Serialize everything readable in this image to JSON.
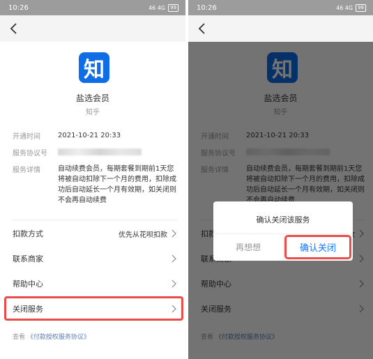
{
  "status_bar": {
    "time": "10:26",
    "signal": "46 4G",
    "battery": "99"
  },
  "service": {
    "logo_char": "知",
    "name": "盐选会员",
    "merchant": "知乎"
  },
  "info": {
    "open_time_label": "开通时间",
    "open_time_value": "2021-10-21 20:33",
    "agreement_no_label": "服务协议号",
    "details_label": "服务详情",
    "details_value": "自动续费会员，每期套餐到期前1天您将被自动扣除下一个月的费用，扣除成功后自动延长一个月有效期，如关闭则不会再自动续费"
  },
  "menu": {
    "payment_method_label": "扣款方式",
    "payment_method_value": "优先从花呗扣款",
    "contact_merchant": "联系商家",
    "help_center": "帮助中心",
    "close_service": "关闭服务"
  },
  "footer": {
    "prefix": "查看",
    "link": "《付款授权服务协议》"
  },
  "dialog": {
    "title": "确认关闭该服务",
    "cancel": "再想想",
    "confirm": "确认关闭"
  },
  "colors": {
    "brand_blue": "#0f6ee6",
    "highlight_red": "#e94b4b",
    "confirm_blue": "#1677ff"
  }
}
